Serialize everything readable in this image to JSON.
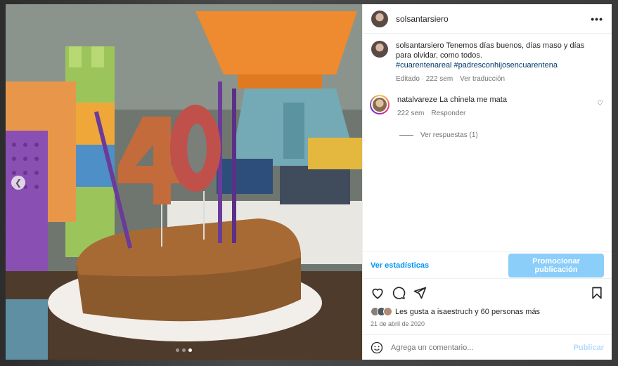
{
  "post": {
    "username": "solsantarsiero",
    "more_label": "•••",
    "caption": {
      "username": "solsantarsiero",
      "text": "Tenemos días buenos, días maso y días para olvidar, como todos.",
      "hashtags": "#cuarentenareal #padresconhijosencuarentena",
      "edited": "Editado · 222 sem",
      "translate": "Ver traducción"
    },
    "comment": {
      "username": "natalvareze",
      "text": "La chinela me mata",
      "time": "222 sem",
      "reply": "Responder",
      "view_replies": "Ver respuestas (1)"
    },
    "stats_link": "Ver estadísticas",
    "promote_button": "Promocionar publicación",
    "likes_text": "Les gusta a isaestruch y 60 personas más",
    "date": "21 de abril de 2020",
    "comment_input": {
      "placeholder": "Agrega un comentario...",
      "publish": "Publicar"
    },
    "carousel": {
      "slides": 3,
      "active": 3
    },
    "cake_number": "40"
  },
  "colors": {
    "link_blue": "#0095f6",
    "promote_bg": "#8ccefa",
    "hashtag": "#00376b",
    "muted": "#737373"
  },
  "icons": [
    "more-icon",
    "heart-icon",
    "comment-icon",
    "share-icon",
    "save-icon",
    "emoji-icon",
    "chevron-left-icon"
  ]
}
